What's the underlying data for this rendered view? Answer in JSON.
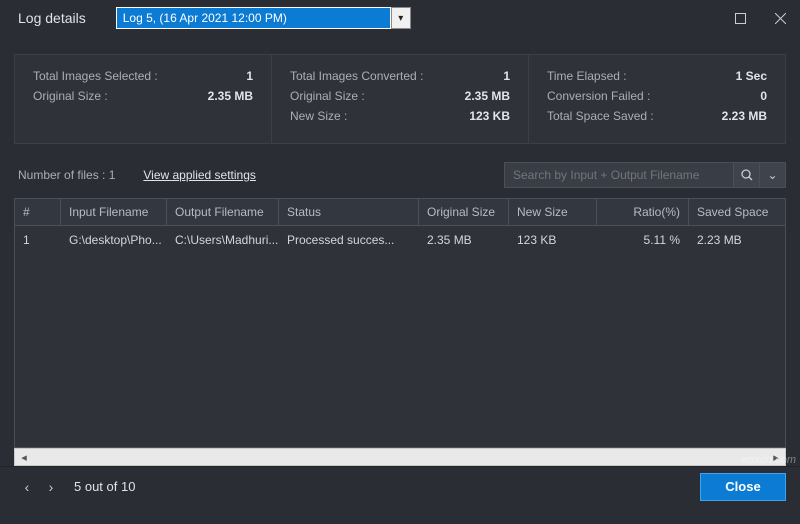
{
  "window": {
    "title": "Log details",
    "selected_log": "Log 5, (16 Apr 2021 12:00 PM)"
  },
  "stats": {
    "col1": {
      "r1": {
        "label": "Total Images Selected :",
        "value": "1"
      },
      "r2": {
        "label": "Original Size :",
        "value": "2.35 MB"
      }
    },
    "col2": {
      "r1": {
        "label": "Total Images Converted :",
        "value": "1"
      },
      "r2": {
        "label": "Original Size :",
        "value": "2.35 MB"
      },
      "r3": {
        "label": "New Size :",
        "value": "123 KB"
      }
    },
    "col3": {
      "r1": {
        "label": "Time Elapsed :",
        "value": "1 Sec"
      },
      "r2": {
        "label": "Conversion Failed :",
        "value": "0"
      },
      "r3": {
        "label": "Total Space Saved :",
        "value": "2.23 MB"
      }
    }
  },
  "toolbar": {
    "count_label": "Number of files : 1",
    "settings_link": "View applied settings",
    "search_placeholder": "Search by Input + Output Filename"
  },
  "table": {
    "headers": {
      "num": "#",
      "in": "Input Filename",
      "out": "Output Filename",
      "status": "Status",
      "osize": "Original Size",
      "nsize": "New Size",
      "ratio": "Ratio(%)",
      "saved": "Saved Space"
    },
    "rows": [
      {
        "num": "1",
        "in": "G:\\desktop\\Pho...",
        "out": "C:\\Users\\Madhuri...",
        "status": "Processed succes...",
        "osize": "2.35 MB",
        "nsize": "123 KB",
        "ratio": "5.11 %",
        "saved": "2.23 MB"
      }
    ]
  },
  "footer": {
    "pager": "5 out of 10",
    "close": "Close"
  },
  "watermark": "wsxdn.com"
}
